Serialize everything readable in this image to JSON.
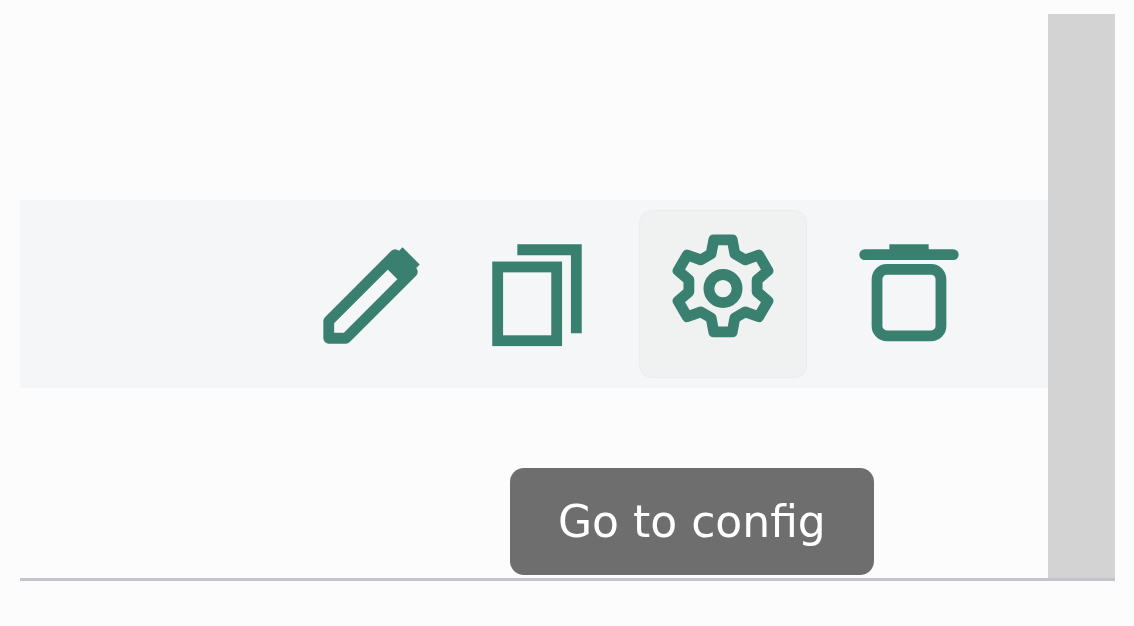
{
  "row_actions": [
    {
      "kind": "edit",
      "hovered": false
    },
    {
      "kind": "copy",
      "hovered": false
    },
    {
      "kind": "config",
      "hovered": true
    },
    {
      "kind": "delete",
      "hovered": false
    }
  ],
  "tooltip": {
    "text": "Go to config"
  }
}
